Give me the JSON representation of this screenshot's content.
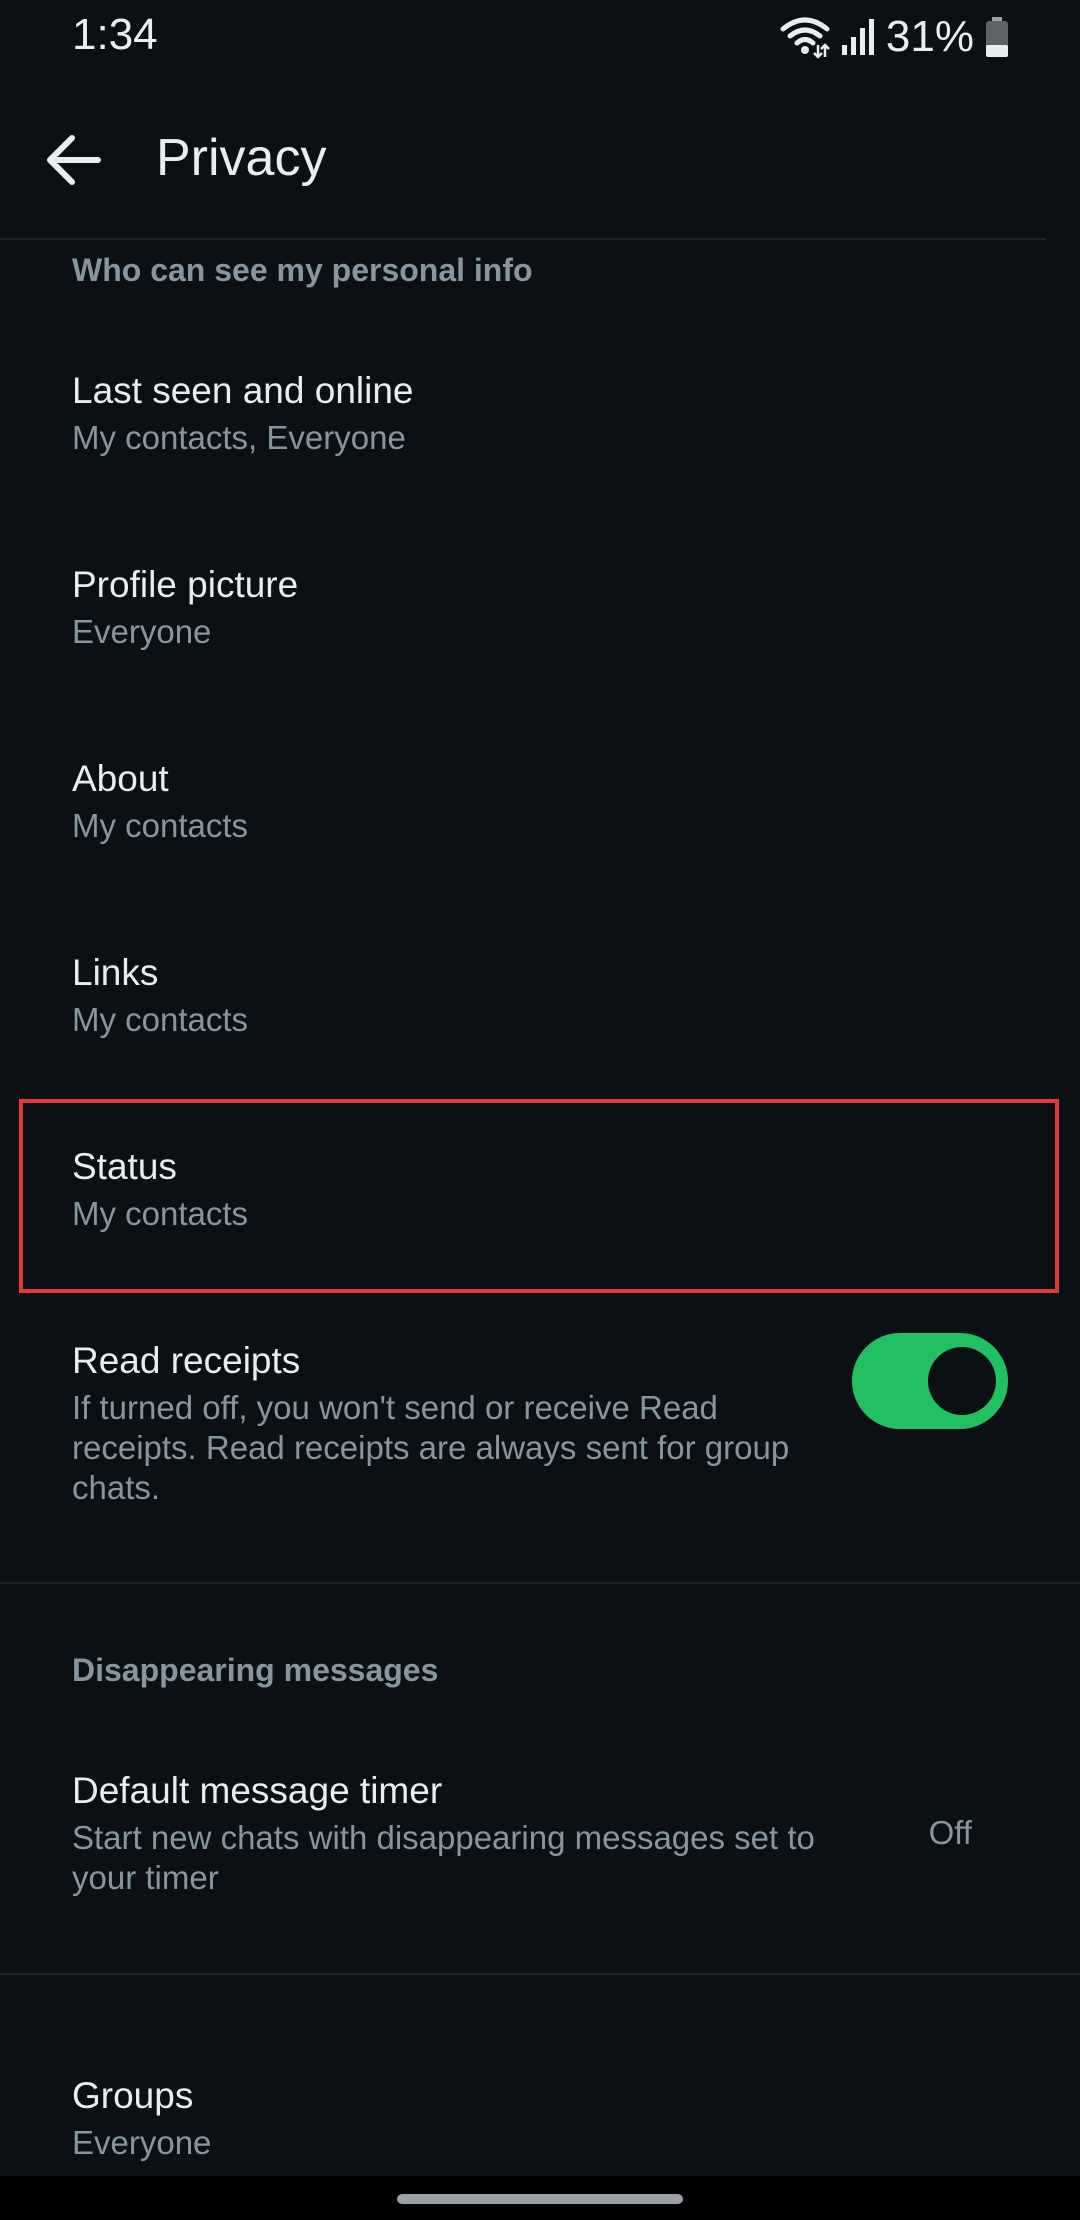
{
  "status_bar": {
    "time": "1:34",
    "battery": "31%"
  },
  "app_bar": {
    "title": "Privacy",
    "back_icon": "arrow-left-icon"
  },
  "sections": {
    "personal_info_header": "Who can see my personal info",
    "disappearing_header": "Disappearing messages"
  },
  "items": {
    "last_seen": {
      "title": "Last seen and online",
      "value": "My contacts, Everyone"
    },
    "profile_picture": {
      "title": "Profile picture",
      "value": "Everyone"
    },
    "about": {
      "title": "About",
      "value": "My contacts"
    },
    "links": {
      "title": "Links",
      "value": "My contacts"
    },
    "status": {
      "title": "Status",
      "value": "My contacts"
    },
    "read_receipts": {
      "title": "Read receipts",
      "description_line1": "If turned off, you won't send or receive Read",
      "description_line2": "receipts. Read receipts are always sent for group",
      "description_line3": "chats.",
      "enabled": true
    },
    "default_timer": {
      "title": "Default message timer",
      "description_line1": "Start new chats with disappearing messages set to",
      "description_line2": "your timer",
      "value": "Off"
    },
    "groups": {
      "title": "Groups",
      "value": "Everyone"
    }
  },
  "colors": {
    "background": "#0b1014",
    "toggle_on": "#21c063",
    "highlight": "#e53935"
  }
}
